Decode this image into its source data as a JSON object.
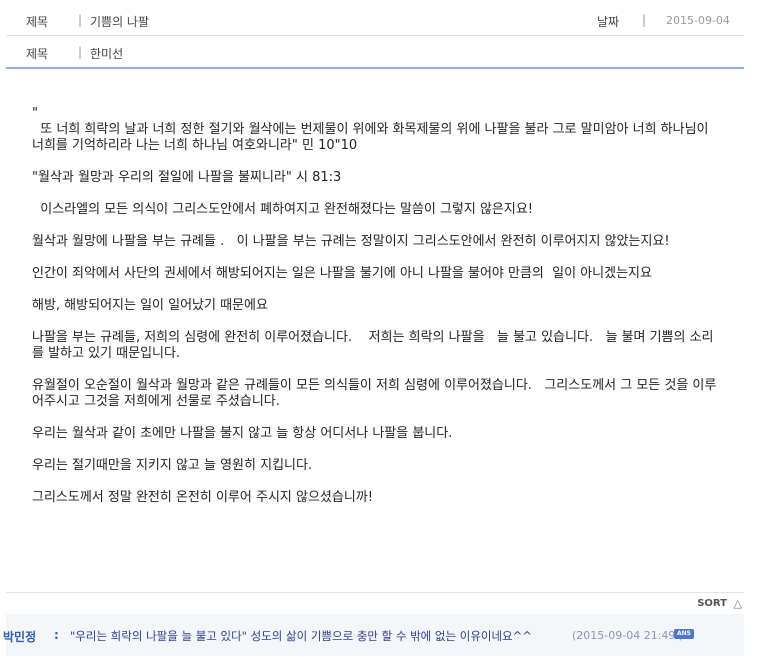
{
  "header": {
    "title_label": "제목",
    "title_value": "기쁨의 나팔",
    "date_label": "날짜",
    "date_value": "2015-09-04",
    "author_label": "제목",
    "author_value": "한미선",
    "separator": "|"
  },
  "content": {
    "paragraphs": [
      "\"",
      "  또 너희 희락의 날과 너희 정한 절기와 월삭에는 번제물이 위에와 화목제물의 위에 나팔을 불라 그로 말미암아 너희 하나님이 너희를 기억하리라 나는 너희 하나님 여호와니라\" 민 10\"10",
      "\"월삭과 월망과 우리의 절일에 나팔을 불찌니라\" 시 81:3",
      "  이스라엘의 모든 의식이 그리스도안에서 폐하여지고 완전해졌다는 말씀이 그렇지 않은지요!",
      "월삭과 월망에 나팔을 부는 규례들 .   이 나팔을 부는 규례는 정말이지 그리스도안에서 완전히 이루어지지 않았는지요!",
      "인간이 죄악에서 사단의 권세에서 해방되어지는 일은 나팔을 불기에 아니 나팔을 불어야 만큼의  일이 아니겠는지요",
      "해방, 해방되어지는 일이 일어났기 때문에요",
      "나팔을 부는 규례들, 저희의 심령에 완전히 이루어졌습니다.    저희는 희락의 나팔을   늘 불고 있습니다.   늘 불며 기쁨의 소리를 발하고 있기 때문입니다.",
      "유월절이 오순절이 월삭과 월망과 같은 규례들이 모든 의식들이 저희 심령에 이루어졌습니다.   그리스도께서 그 모든 것을 이루어주시고 그것을 저희에게 선물로 주셨습니다.",
      "우리는 월삭과 같이 초에만 나팔을 불지 않고 늘 항상 어디서나 나팔을 붑니다.",
      "우리는 절기때만을 지키지 않고 늘 영원히 지킵니다.",
      "그리스도께서 정말 완전히 온전히 이루어 주시지 않으셨습니까!"
    ]
  },
  "sort": {
    "label": "SORT",
    "icon": "triangle-up-icon"
  },
  "comment": {
    "author": "박민정",
    "colon": ":",
    "text": "\"우리는 희락의 나팔을 늘 불고 있다\" 성도의 삶이 기쁨으로 충만 할 수 밖에 없는 이유이네요^^",
    "time": "(2015-09-04 21:49 )",
    "badge": "ANS"
  },
  "colors": {
    "accent_border": "#8fb0d8",
    "comment_author": "#2b5fa8",
    "comment_text": "#2f3f8f",
    "badge_bg": "#4a78c4"
  }
}
